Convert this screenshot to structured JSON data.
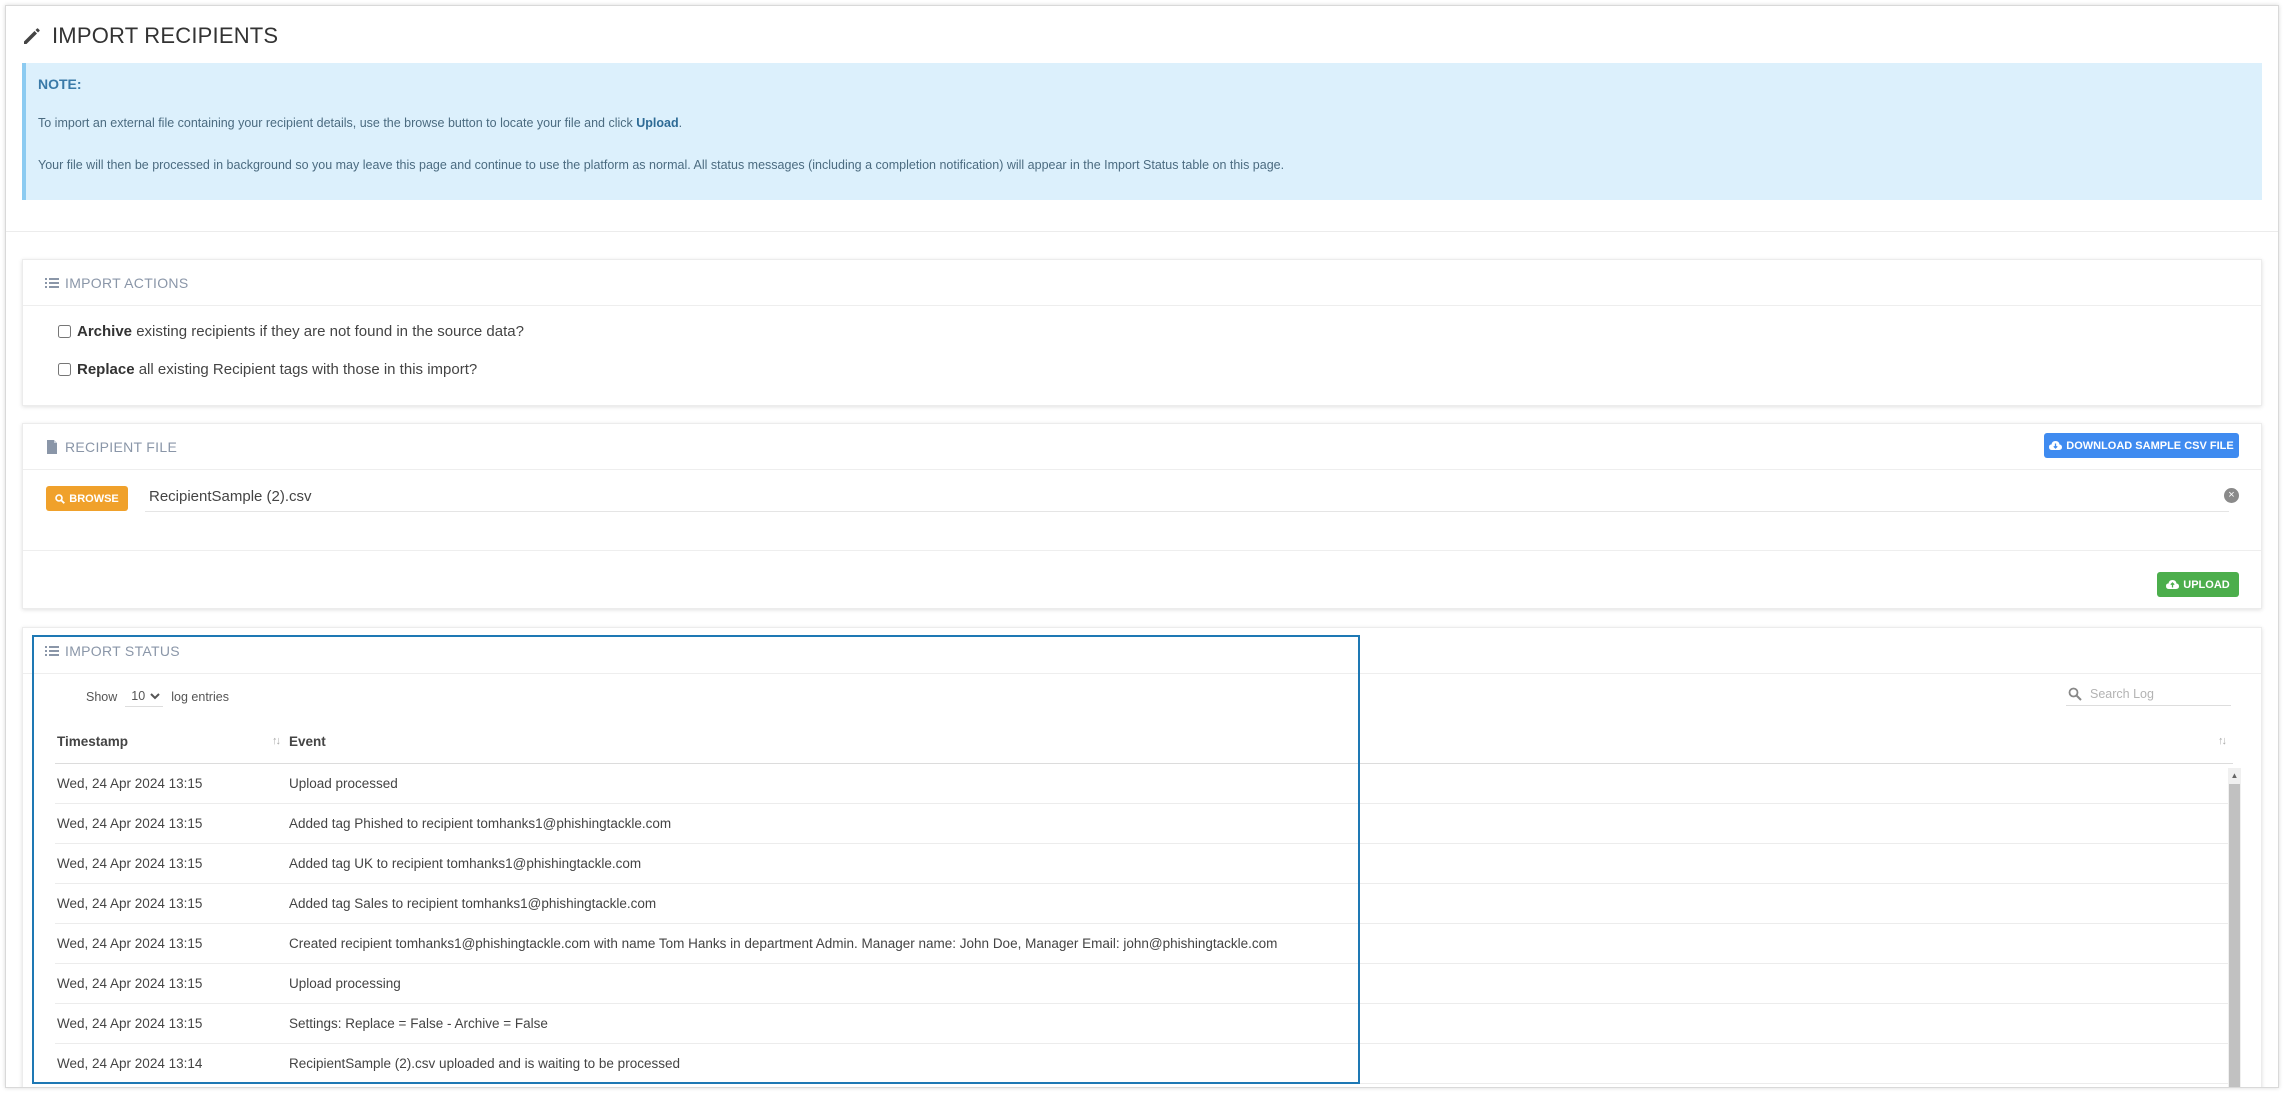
{
  "page": {
    "title": "IMPORT RECIPIENTS"
  },
  "note": {
    "title": "NOTE:",
    "line1_pre": "To import an external file containing your recipient details, use the browse button to locate your file and click ",
    "line1_bold": "Upload",
    "line1_post": ".",
    "line2": "Your file will then be processed in background so you may leave this page and continue to use the platform as normal. All status messages (including a completion notification) will appear in the Import Status table on this page."
  },
  "import_actions": {
    "title": "IMPORT ACTIONS",
    "archive": {
      "bold": "Archive",
      "text": " existing recipients if they are not found in the source data?"
    },
    "replace": {
      "bold": "Replace",
      "text": " all existing Recipient tags with those in this import?"
    }
  },
  "recipient_file": {
    "title": "RECIPIENT FILE",
    "download_label": "DOWNLOAD SAMPLE CSV FILE",
    "browse_label": "BROWSE",
    "file_name": "RecipientSample (2).csv",
    "clear_symbol": "×",
    "upload_label": "UPLOAD"
  },
  "import_status": {
    "title": "IMPORT STATUS",
    "show_label": "Show",
    "page_size": "10",
    "entries_label": "log entries",
    "search_placeholder": "Search Log",
    "columns": {
      "timestamp": "Timestamp",
      "event": "Event"
    },
    "sort_glyph": "↑↓",
    "rows": [
      {
        "timestamp": "Wed, 24 Apr 2024 13:15",
        "event": "Upload processed"
      },
      {
        "timestamp": "Wed, 24 Apr 2024 13:15",
        "event": "Added tag Phished to recipient tomhanks1@phishingtackle.com"
      },
      {
        "timestamp": "Wed, 24 Apr 2024 13:15",
        "event": "Added tag UK to recipient tomhanks1@phishingtackle.com"
      },
      {
        "timestamp": "Wed, 24 Apr 2024 13:15",
        "event": "Added tag Sales to recipient tomhanks1@phishingtackle.com"
      },
      {
        "timestamp": "Wed, 24 Apr 2024 13:15",
        "event": "Created recipient tomhanks1@phishingtackle.com with name Tom Hanks in department Admin. Manager name: John Doe, Manager Email: john@phishingtackle.com"
      },
      {
        "timestamp": "Wed, 24 Apr 2024 13:15",
        "event": "Upload processing"
      },
      {
        "timestamp": "Wed, 24 Apr 2024 13:15",
        "event": "Settings: Replace = False - Archive = False"
      },
      {
        "timestamp": "Wed, 24 Apr 2024 13:14",
        "event": "RecipientSample (2).csv uploaded and is waiting to be processed"
      }
    ]
  },
  "colors": {
    "note_bg": "#dcf0fc",
    "download_btn": "#3f8bf0",
    "browse_btn": "#f0a12b",
    "upload_btn": "#4cae4c",
    "highlight": "#1e78b4"
  }
}
